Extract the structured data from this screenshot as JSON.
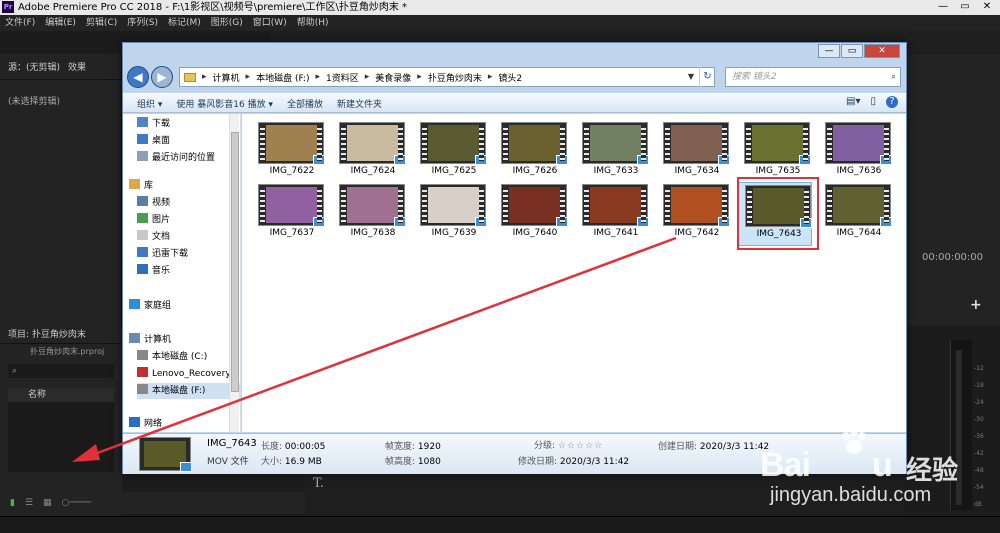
{
  "app": {
    "logo": "Pr",
    "title": "Adobe Premiere Pro CC 2018 - F:\\1影视区\\视频号\\premiere\\工作区\\扑豆角炒肉末 *"
  },
  "menu": [
    "文件(F)",
    "编辑(E)",
    "剪辑(C)",
    "序列(S)",
    "标记(M)",
    "图形(G)",
    "窗口(W)",
    "帮助(H)"
  ],
  "source": {
    "tab1": "源：(无剪辑)",
    "tab2": "效果",
    "empty": "(未选择剪辑)"
  },
  "project": {
    "tab": "项目: 扑豆角炒肉末",
    "file": "扑豆角炒肉末.prproj",
    "col_name": "名称"
  },
  "program": {
    "timecode": "00:00:00:00",
    "tool_t": "T."
  },
  "meter": {
    "labels": [
      "-12",
      "-18",
      "-24",
      "-30",
      "-36",
      "-42",
      "-48",
      "-54",
      "dB"
    ]
  },
  "dialog": {
    "breadcrumb": [
      "计算机",
      "本地磁盘 (F:)",
      "1资料区",
      "美食录像",
      "扑豆角炒肉末",
      "镜头2"
    ],
    "search_placeholder": "搜索 镜头2",
    "toolbar": {
      "organize": "组织 ▾",
      "open_with": "使用 暴风影音16 播放 ▾",
      "all_play": "全部播放",
      "new_folder": "新建文件夹"
    },
    "nav": [
      {
        "label": "下载",
        "color": "#4a86c8"
      },
      {
        "label": "桌面",
        "color": "#3d7bc8"
      },
      {
        "label": "最近访问的位置",
        "color": "#8aa0b8"
      },
      {
        "label": "库",
        "color": "#d9a94a"
      },
      {
        "label": "视频",
        "color": "#5a7da8"
      },
      {
        "label": "图片",
        "color": "#4b9c4b"
      },
      {
        "label": "文档",
        "color": "#c8c8c8"
      },
      {
        "label": "迅雷下载",
        "color": "#3d7bc8"
      },
      {
        "label": "音乐",
        "color": "#2f6fb7"
      },
      {
        "label": "家庭组",
        "color": "#2b8fd6"
      },
      {
        "label": "计算机",
        "color": "#6a8ab0"
      },
      {
        "label": "本地磁盘 (C:)",
        "color": "#888888"
      },
      {
        "label": "Lenovo_Recovery",
        "color": "#c03030"
      },
      {
        "label": "本地磁盘 (F:)",
        "color": "#888888"
      },
      {
        "label": "网络",
        "color": "#2b6cc4"
      }
    ],
    "files": [
      {
        "name": "IMG_7622",
        "color": "#a08050"
      },
      {
        "name": "IMG_7624",
        "color": "#c9bba0"
      },
      {
        "name": "IMG_7625",
        "color": "#5a5a30"
      },
      {
        "name": "IMG_7626",
        "color": "#6a6030"
      },
      {
        "name": "IMG_7633",
        "color": "#708060"
      },
      {
        "name": "IMG_7634",
        "color": "#806050"
      },
      {
        "name": "IMG_7635",
        "color": "#6a7030"
      },
      {
        "name": "IMG_7636",
        "color": "#8060a0"
      },
      {
        "name": "IMG_7637",
        "color": "#9060a0"
      },
      {
        "name": "IMG_7638",
        "color": "#a07090"
      },
      {
        "name": "IMG_7639",
        "color": "#d8d0c8"
      },
      {
        "name": "IMG_7640",
        "color": "#7a3020"
      },
      {
        "name": "IMG_7641",
        "color": "#8a3a20"
      },
      {
        "name": "IMG_7642",
        "color": "#b05020"
      },
      {
        "name": "IMG_7643",
        "color": "#5a5a28"
      },
      {
        "name": "IMG_7644",
        "color": "#606030"
      }
    ],
    "details": {
      "name": "IMG_7643",
      "type": "MOV 文件",
      "length_k": "长度:",
      "length_v": "00:00:05",
      "size_k": "大小:",
      "size_v": "16.9 MB",
      "fw_k": "帧宽度:",
      "fw_v": "1920",
      "fh_k": "帧高度:",
      "fh_v": "1080",
      "rating_k": "分级:",
      "stars": "☆☆☆☆☆",
      "modified_k": "修改日期:",
      "modified_v": "2020/3/3 11:42",
      "created_k": "创建日期:",
      "created_v": "2020/3/3 11:42"
    }
  },
  "watermark": {
    "text": "Bai",
    "text2": "u",
    "cn": "经验",
    "url": "jingyan.baidu.com"
  },
  "colors": {
    "highlight": "#e0303a",
    "arrow": "#e0303a"
  }
}
